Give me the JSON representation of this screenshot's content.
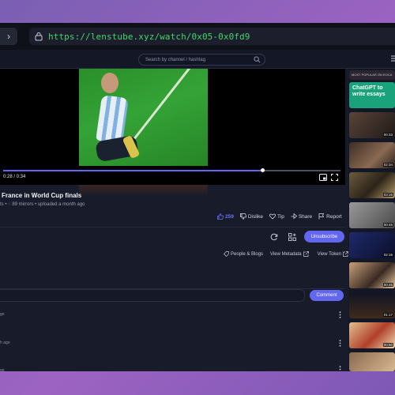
{
  "browser": {
    "nav_icon": "chevron-right-icon",
    "url": "https://lenstube.xyz/watch/0x05-0x0fd9"
  },
  "header": {
    "search_placeholder": "Search by channel / hashtag"
  },
  "player": {
    "time": "0:28 / 0:34",
    "progress": 0.77
  },
  "video": {
    "title": "France in World Cup finals",
    "meta": "ts • ◌ 89 mirrors • uploaded a month ago"
  },
  "actions": {
    "likes": "259",
    "dislike": "Dislike",
    "tip": "Tip",
    "share": "Share",
    "report": "Report"
  },
  "channel": {
    "unsubscribe": "Unsubscribe"
  },
  "categories": {
    "category": "People & Blogs",
    "view_metadata": "View Metadata",
    "view_token": "View Token"
  },
  "comments": {
    "button": "Comment",
    "items": [
      {
        "time": "go"
      },
      {
        "time": "h ago"
      },
      {
        "time": "go"
      }
    ]
  },
  "sidebar": {
    "items": [
      {
        "duration": "",
        "text": "MOST POPULAR ON EOCA"
      },
      {
        "duration": "",
        "text": "ChatGPT to write essays"
      },
      {
        "duration": "00:33"
      },
      {
        "duration": "02:34"
      },
      {
        "duration": "03:15"
      },
      {
        "duration": "00:45"
      },
      {
        "duration": "02:16"
      },
      {
        "duration": "00:45"
      },
      {
        "duration": "01:17"
      },
      {
        "duration": "00:50"
      }
    ]
  },
  "colors": {
    "accent": "#6266f0",
    "url_green": "#3fd66a",
    "background": "#181c2a"
  }
}
